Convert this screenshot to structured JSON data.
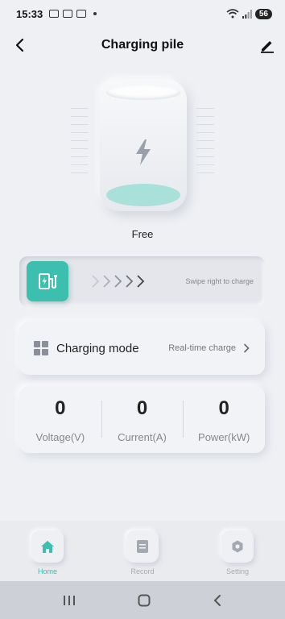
{
  "status_bar": {
    "time": "15:33",
    "battery": "56"
  },
  "header": {
    "title": "Charging pile"
  },
  "pile": {
    "status": "Free"
  },
  "swipe": {
    "hint": "Swipe right to charge"
  },
  "mode": {
    "label": "Charging mode",
    "value": "Real-time charge"
  },
  "metrics": [
    {
      "value": "0",
      "label": "Voltage(V)"
    },
    {
      "value": "0",
      "label": "Current(A)"
    },
    {
      "value": "0",
      "label": "Power(kW)"
    }
  ],
  "nav": [
    {
      "label": "Home",
      "icon": "home-icon",
      "active": true
    },
    {
      "label": "Record",
      "icon": "record-icon",
      "active": false
    },
    {
      "label": "Setting",
      "icon": "setting-icon",
      "active": false
    }
  ],
  "colors": {
    "accent": "#3cbfae",
    "background": "#eef0f4"
  }
}
